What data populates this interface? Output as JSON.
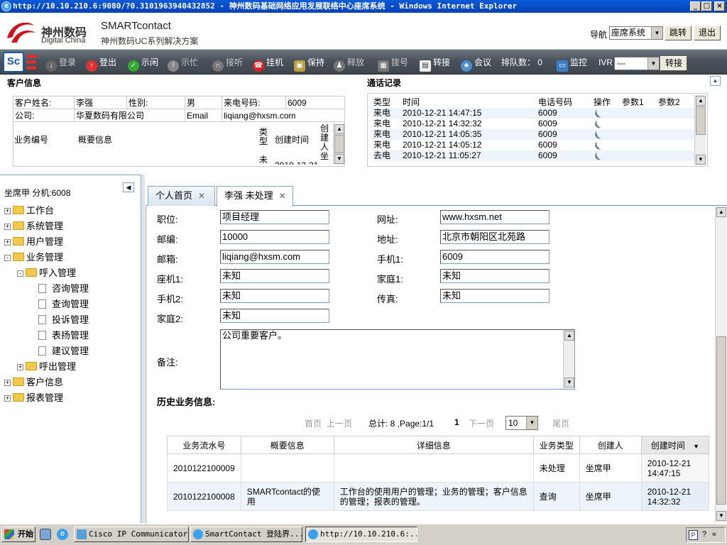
{
  "window": {
    "title": "http://10.10.210.6:9080/?0.3101963940432852 - 神州数码基础网络应用发展联络中心座席系统 - Windows Internet Explorer"
  },
  "header": {
    "logo_cn": "神州数码",
    "logo_en": "Digital China",
    "brand_title": "SMARTcontact",
    "brand_subtitle": "神州数码UC系列解决方案",
    "nav_label": "导航",
    "nav_selected": "座席系统",
    "jump_label": "跳转",
    "exit_label": "退出"
  },
  "toolbar": {
    "logo": "Sc",
    "login": "登录",
    "logout": "登出",
    "ready": "示闲",
    "busy": "示忙",
    "answer": "接听",
    "hangup": "挂机",
    "hold": "保持",
    "release": "释放",
    "dial": "拨号",
    "transfer": "转接",
    "conference": "会议",
    "queue_label": "排队数：",
    "queue_count": "0",
    "monitor": "监控",
    "ivr_label": "IVR",
    "ivr_selected": "---",
    "ivr_transfer": "转接"
  },
  "customer": {
    "section_title": "客户信息",
    "name_label": "客户姓名:",
    "name": "李强",
    "gender_label": "性别:",
    "gender": "男",
    "caller_label": "来电号码:",
    "caller": "6009",
    "company_label": "公司:",
    "company": "华夏数码有限公司",
    "email_label": "Email",
    "email": "liqiang@hxsm.com",
    "biz_no_col": "业务编号",
    "summary_col": "概要信息",
    "type_col": "类型",
    "created_col": "创建时间",
    "creator_col": "创建人",
    "partial_type": "未",
    "partial_date": "2010-12-21",
    "partial_creator": "坐"
  },
  "calls": {
    "section_title": "通话记录",
    "columns": [
      "类型",
      "时间",
      "电话号码",
      "操作",
      "参数1",
      "参数2"
    ],
    "rows": [
      {
        "type": "来电",
        "time": "2010-12-21 14:47:15",
        "phone": "6009"
      },
      {
        "type": "来电",
        "time": "2010-12-21 14:32:32",
        "phone": "6009"
      },
      {
        "type": "来电",
        "time": "2010-12-21 14:05:35",
        "phone": "6009"
      },
      {
        "type": "来电",
        "time": "2010-12-21 14:05:12",
        "phone": "6009"
      },
      {
        "type": "去电",
        "time": "2010-12-21 11:05:27",
        "phone": "6009"
      }
    ]
  },
  "sidebar": {
    "agent": "坐席甲  分机:6008",
    "tree": [
      {
        "label": "工作台",
        "level": 0,
        "node": "folder",
        "exp": "+"
      },
      {
        "label": "系统管理",
        "level": 0,
        "node": "folder",
        "exp": "+"
      },
      {
        "label": "用户管理",
        "level": 0,
        "node": "folder",
        "exp": "+"
      },
      {
        "label": "业务管理",
        "level": 0,
        "node": "folder",
        "exp": "-"
      },
      {
        "label": "呼入管理",
        "level": 1,
        "node": "folder",
        "exp": "-"
      },
      {
        "label": "咨询管理",
        "level": 2,
        "node": "doc",
        "exp": ""
      },
      {
        "label": "查询管理",
        "level": 2,
        "node": "doc",
        "exp": ""
      },
      {
        "label": "投诉管理",
        "level": 2,
        "node": "doc",
        "exp": ""
      },
      {
        "label": "表扬管理",
        "level": 2,
        "node": "doc",
        "exp": ""
      },
      {
        "label": "建议管理",
        "level": 2,
        "node": "doc",
        "exp": ""
      },
      {
        "label": "呼出管理",
        "level": 1,
        "node": "folder",
        "exp": "+"
      },
      {
        "label": "客户信息",
        "level": 0,
        "node": "folder",
        "exp": "+"
      },
      {
        "label": "报表管理",
        "level": 0,
        "node": "folder",
        "exp": "+"
      }
    ]
  },
  "tabs": [
    {
      "label": "个人首页"
    },
    {
      "label": "李强 未处理"
    }
  ],
  "form": {
    "position_label": "职位:",
    "position": "项目经理",
    "website_label": "网址:",
    "website": "www.hxsm.net",
    "zip_label": "邮编:",
    "zip": "10000",
    "address_label": "地址:",
    "address": "北京市朝阳区北苑路",
    "email_label": "邮箱:",
    "email": "liqiang@hxsm.com",
    "mobile1_label": "手机1:",
    "mobile1": "6009",
    "landline1_label": "座机1:",
    "landline1": "未知",
    "home1_label": "家庭1:",
    "home1": "未知",
    "mobile2_label": "手机2:",
    "mobile2": "未知",
    "fax_label": "传真:",
    "fax": "未知",
    "home2_label": "家庭2:",
    "home2": "未知",
    "note_label": "备注:",
    "note": "公司重要客户。"
  },
  "history": {
    "title": "历史业务信息:",
    "pager": {
      "first": "首页",
      "prev": "上一页",
      "total": "总计: 8 ,Page:1/1",
      "current": "1",
      "next": "下一页",
      "page_size": "10",
      "last": "尾页"
    },
    "columns": [
      "业务流水号",
      "概要信息",
      "详细信息",
      "业务类型",
      "创建人",
      "创建时间"
    ],
    "rows": [
      {
        "id": "2010122100009",
        "summary": "",
        "detail": "",
        "type": "未处理",
        "creator": "坐席甲",
        "created": "2010-12-21 14:47:15"
      },
      {
        "id": "2010122100008",
        "summary": "SMARTcontact的使用",
        "detail": "工作台的使用用户的管理；业务的管理；客户信息的管理；报表的管理。",
        "type": "查询",
        "creator": "坐席甲",
        "created": "2010-12-21 14:32:32"
      }
    ]
  },
  "taskbar": {
    "start": "开始",
    "tasks": [
      "Cisco IP Communicator",
      "SmartContact 登陆界...",
      "http://10.10.210.6:..."
    ]
  }
}
